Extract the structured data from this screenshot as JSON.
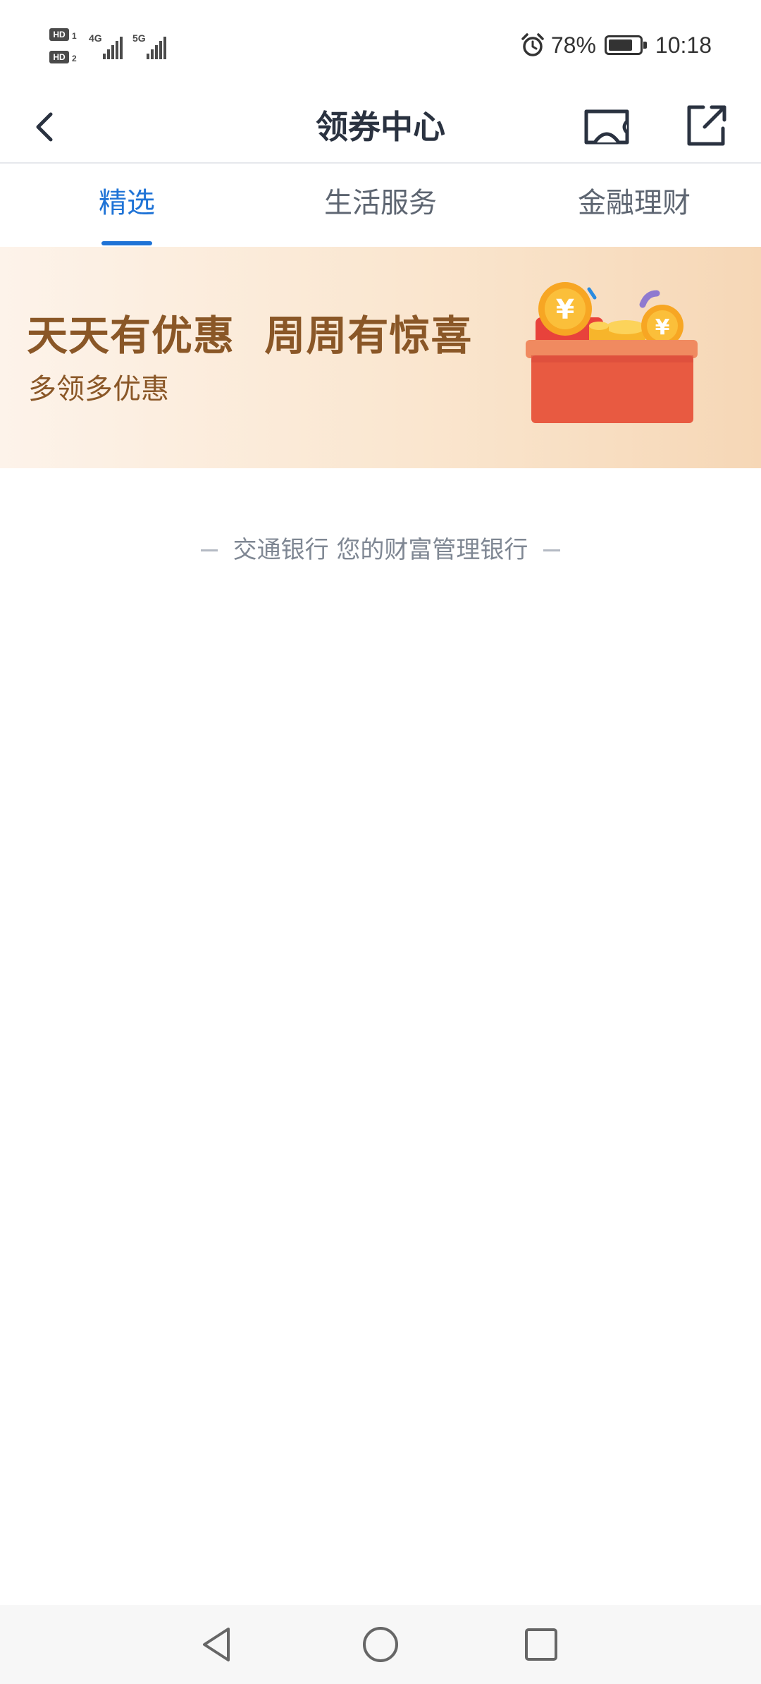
{
  "status_bar": {
    "sim1_badge": "HD",
    "sim1_index": "1",
    "sim2_badge": "HD",
    "sim2_index": "2",
    "network1": "4G",
    "network2": "5G",
    "battery_percent": "78%",
    "battery_level": 0.78,
    "time": "10:18",
    "icons": [
      "alarm-icon",
      "battery-icon",
      "signal-icon"
    ]
  },
  "nav": {
    "title": "领券中心",
    "icons": [
      "back-arrow-icon",
      "ticket-icon",
      "share-icon"
    ]
  },
  "tabs": [
    {
      "label": "精选",
      "active": true
    },
    {
      "label": "生活服务",
      "active": false
    },
    {
      "label": "金融理财",
      "active": false
    }
  ],
  "banner": {
    "headline": "天天有优惠  周周有惊喜",
    "subtitle": "多领多优惠",
    "illustration": "gift-box-icon"
  },
  "footer_slogan": "交通银行 您的财富管理银行",
  "system_nav": {
    "icons": [
      "back-triangle-icon",
      "home-circle-icon",
      "recents-square-icon"
    ]
  },
  "colors": {
    "accent": "#1f73d6",
    "banner_text": "#8a5727",
    "title_text": "#2a3240",
    "muted_text": "#7f8793"
  }
}
